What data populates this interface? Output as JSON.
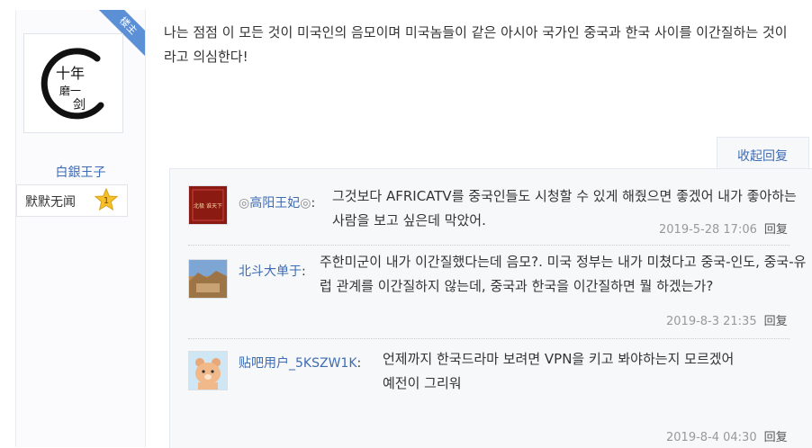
{
  "post": {
    "floor_badge": "楼主",
    "author": "白銀王子",
    "badge_text": "默默无闻",
    "badge_level": "1",
    "avatar_text_line1": "十年",
    "avatar_text_line2": "磨一",
    "avatar_text_line3": "剑",
    "content": "나는 점점 이 모든 것이 미국인의 음모이며 미국놈들이 같은 아시아 국가인 중국과 한국 사이를 이간질하는 것이라고 의심한다!"
  },
  "replies_toggle": "收起回复",
  "replies": [
    {
      "author": "高阳王妃",
      "prefix_icon": "◎",
      "suffix_icon": "◎",
      "separator": ":",
      "avatar_text": "北极 谁天下",
      "text": "그것보다 AFRICATV를 중국인들도 시청할 수 있게 해줬으면 좋겠어 내가 좋아하는 사람을 보고 싶은데 막았어.",
      "time": "2019-5-28 17:06",
      "reply_label": "回复"
    },
    {
      "author": "北斗大单于",
      "separator": ":",
      "text": "주한미군이 내가 이간질했다는데 음모?. 미국 정부는 내가 미쳤다고 중국-인도, 중국-유럽 관계를 이간질하지 않는데, 중국과 한국을 이간질하면 뭘 하겠는가?",
      "time": "2019-8-3 21:35",
      "reply_label": "回复"
    },
    {
      "author": "贴吧用户_5KSZW1K",
      "separator": ":",
      "text_line1": "언제까지 한국드라마 보려면 VPN을 키고 봐야하는지 모르겠어",
      "text_line2": "예전이 그리워",
      "time": "2019-8-4 04:30",
      "reply_label": "回复"
    }
  ],
  "colors": {
    "link": "#3e6bb3",
    "ribbon": "#5b8fd6",
    "replies_bg": "#f7f8fa",
    "badge_level": "#f5c02a"
  }
}
